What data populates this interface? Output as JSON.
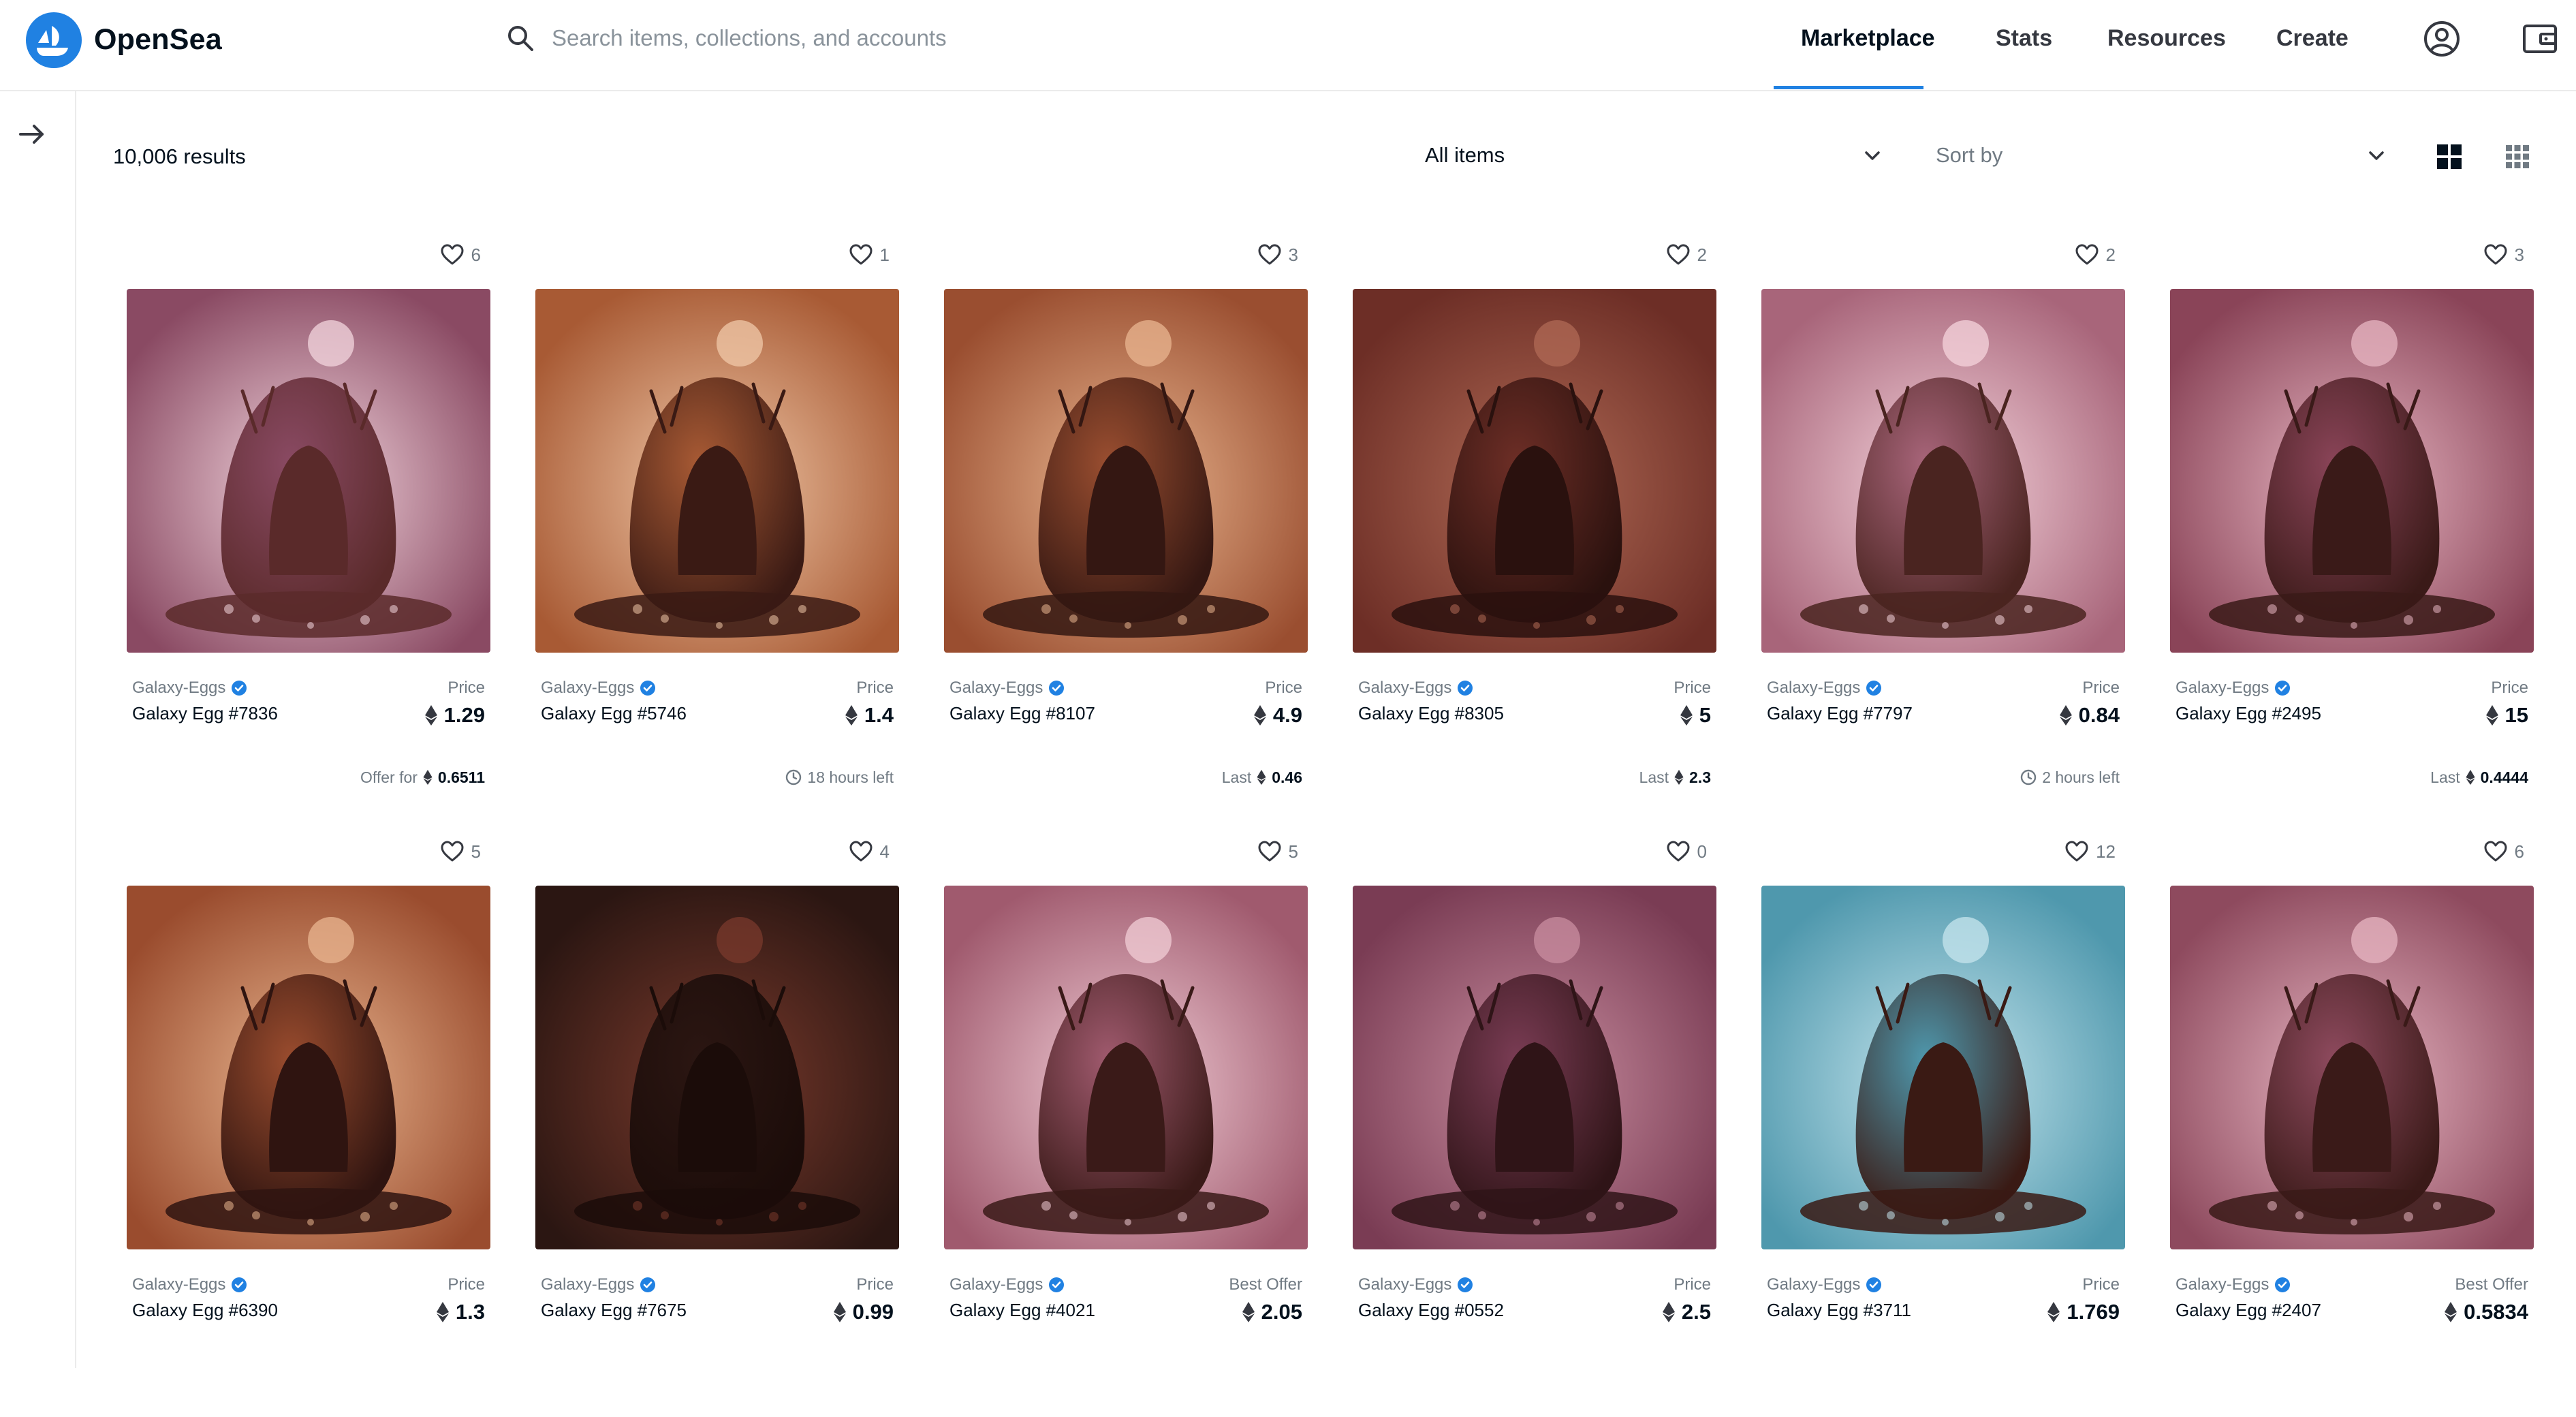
{
  "header": {
    "brand": "OpenSea",
    "search_placeholder": "Search items, collections, and accounts",
    "nav": {
      "marketplace": "Marketplace",
      "stats": "Stats",
      "resources": "Resources",
      "create": "Create"
    }
  },
  "toolbar": {
    "results": "10,006 results",
    "filter_selected": "All items",
    "sort_placeholder": "Sort by"
  },
  "colors": {
    "brand_blue": "#2081e2",
    "verified_blue": "#2081e2",
    "text_primary": "#04111d",
    "text_muted": "#707a83"
  },
  "cards": [
    {
      "likes": "6",
      "collection": "Galaxy-Eggs",
      "name": "Galaxy Egg #7836",
      "price_label": "Price",
      "price": "1.29",
      "footer_label": "Offer for",
      "footer_value": "0.6511",
      "footer_type": "eth"
    },
    {
      "likes": "1",
      "collection": "Galaxy-Eggs",
      "name": "Galaxy Egg #5746",
      "price_label": "Price",
      "price": "1.4",
      "footer_label": "18 hours left",
      "footer_value": "",
      "footer_type": "time"
    },
    {
      "likes": "3",
      "collection": "Galaxy-Eggs",
      "name": "Galaxy Egg #8107",
      "price_label": "Price",
      "price": "4.9",
      "footer_label": "Last",
      "footer_value": "0.46",
      "footer_type": "eth"
    },
    {
      "likes": "2",
      "collection": "Galaxy-Eggs",
      "name": "Galaxy Egg #8305",
      "price_label": "Price",
      "price": "5",
      "footer_label": "Last",
      "footer_value": "2.3",
      "footer_type": "eth"
    },
    {
      "likes": "2",
      "collection": "Galaxy-Eggs",
      "name": "Galaxy Egg #7797",
      "price_label": "Price",
      "price": "0.84",
      "footer_label": "2 hours left",
      "footer_value": "",
      "footer_type": "time"
    },
    {
      "likes": "3",
      "collection": "Galaxy-Eggs",
      "name": "Galaxy Egg #2495",
      "price_label": "Price",
      "price": "15",
      "footer_label": "Last",
      "footer_value": "0.4444",
      "footer_type": "eth"
    },
    {
      "likes": "5",
      "collection": "Galaxy-Eggs",
      "name": "Galaxy Egg #6390",
      "price_label": "Price",
      "price": "1.3",
      "footer_label": "",
      "footer_value": "",
      "footer_type": "none"
    },
    {
      "likes": "4",
      "collection": "Galaxy-Eggs",
      "name": "Galaxy Egg #7675",
      "price_label": "Price",
      "price": "0.99",
      "footer_label": "",
      "footer_value": "",
      "footer_type": "none"
    },
    {
      "likes": "5",
      "collection": "Galaxy-Eggs",
      "name": "Galaxy Egg #4021",
      "price_label": "Best Offer",
      "price": "2.05",
      "footer_label": "",
      "footer_value": "",
      "footer_type": "none"
    },
    {
      "likes": "0",
      "collection": "Galaxy-Eggs",
      "name": "Galaxy Egg #0552",
      "price_label": "Price",
      "price": "2.5",
      "footer_label": "",
      "footer_value": "",
      "footer_type": "none"
    },
    {
      "likes": "12",
      "collection": "Galaxy-Eggs",
      "name": "Galaxy Egg #3711",
      "price_label": "Price",
      "price": "1.769",
      "footer_label": "",
      "footer_value": "",
      "footer_type": "none"
    },
    {
      "likes": "6",
      "collection": "Galaxy-Eggs",
      "name": "Galaxy Egg #2407",
      "price_label": "Best Offer",
      "price": "0.5834",
      "footer_label": "",
      "footer_value": "",
      "footer_type": "none"
    }
  ]
}
